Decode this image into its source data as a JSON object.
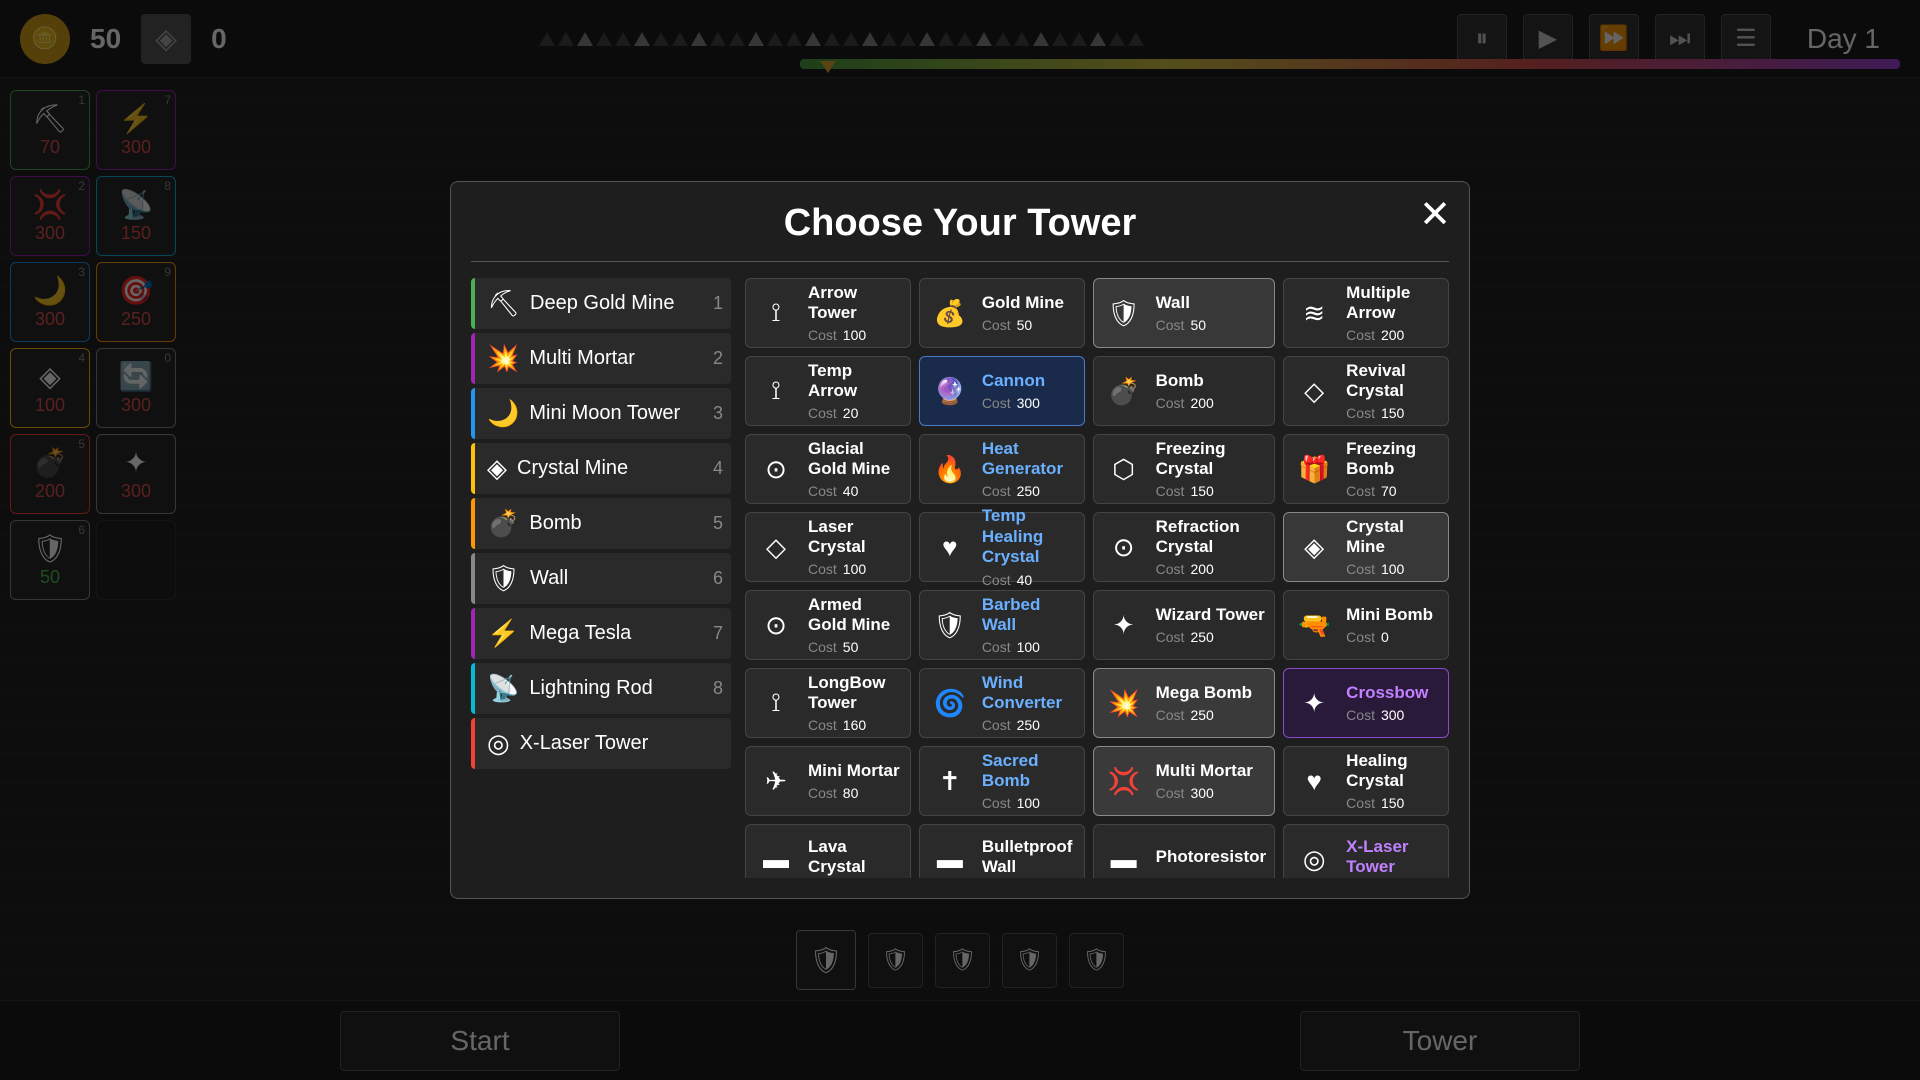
{
  "topbar": {
    "gold": "50",
    "crystals": "0",
    "day": "Day 1",
    "controls": {
      "pause": "⏸",
      "play": "▶",
      "fast": "⏩",
      "faster": "⏭",
      "menu": "☰"
    }
  },
  "modal": {
    "title": "Choose Your Tower",
    "close": "✕",
    "list": [
      {
        "name": "Deep Gold Mine",
        "icon": "⛏",
        "num": "1",
        "border": "green"
      },
      {
        "name": "Multi Mortar",
        "icon": "💥",
        "num": "2",
        "border": "purple"
      },
      {
        "name": "Mini Moon Tower",
        "icon": "🌙",
        "num": "3",
        "border": "blue"
      },
      {
        "name": "Crystal Mine",
        "icon": "◈",
        "num": "4",
        "border": "yellow"
      },
      {
        "name": "Bomb",
        "icon": "💣",
        "num": "5",
        "border": "orange"
      },
      {
        "name": "Wall",
        "icon": "🛡",
        "num": "6",
        "border": "gray"
      },
      {
        "name": "Mega Tesla",
        "icon": "⚡",
        "num": "7",
        "border": "purple"
      },
      {
        "name": "Lightning Rod",
        "icon": "📡",
        "num": "8",
        "border": "cyan"
      },
      {
        "name": "X-Laser Tower",
        "icon": "◎",
        "num": "",
        "border": "red"
      }
    ],
    "grid": [
      {
        "name": "Arrow Tower",
        "icon": "🏹",
        "cost": "100",
        "style": "normal"
      },
      {
        "name": "Gold Mine",
        "icon": "💰",
        "cost": "50",
        "style": "normal"
      },
      {
        "name": "Wall",
        "icon": "🛡",
        "cost": "50",
        "style": "selected-gray"
      },
      {
        "name": "Multiple Arrow",
        "icon": "≋",
        "cost": "200",
        "style": "normal"
      },
      {
        "name": "Temp Arrow",
        "icon": "🏹",
        "cost": "20",
        "style": "normal"
      },
      {
        "name": "Cannon",
        "icon": "🔮",
        "cost": "300",
        "style": "selected-blue",
        "nameColor": "blue"
      },
      {
        "name": "Bomb",
        "icon": "💣",
        "cost": "200",
        "style": "normal"
      },
      {
        "name": "Revival Crystal",
        "icon": "◇",
        "cost": "150",
        "style": "normal"
      },
      {
        "name": "Glacial Gold Mine",
        "icon": "⊙",
        "cost": "40",
        "style": "normal"
      },
      {
        "name": "Heat Generator",
        "icon": "🔥",
        "cost": "250",
        "style": "normal",
        "nameColor": "blue"
      },
      {
        "name": "Freezing Crystal",
        "icon": "⬡",
        "cost": "150",
        "style": "normal"
      },
      {
        "name": "Freezing Bomb",
        "icon": "🎁",
        "cost": "70",
        "style": "normal"
      },
      {
        "name": "Laser Crystal",
        "icon": "◇",
        "cost": "100",
        "style": "normal"
      },
      {
        "name": "Temp Healing Crystal",
        "icon": "♥",
        "cost": "40",
        "style": "normal",
        "nameColor": "blue"
      },
      {
        "name": "Refraction Crystal",
        "icon": "⊙",
        "cost": "200",
        "style": "normal"
      },
      {
        "name": "Crystal Mine",
        "icon": "◈",
        "cost": "100",
        "style": "selected-gray"
      },
      {
        "name": "Armed Gold Mine",
        "icon": "⊙",
        "cost": "50",
        "style": "normal"
      },
      {
        "name": "Barbed Wall",
        "icon": "🛡",
        "cost": "100",
        "style": "normal",
        "nameColor": "blue"
      },
      {
        "name": "Wizard Tower",
        "icon": "✦",
        "cost": "250",
        "style": "normal"
      },
      {
        "name": "Mini Bomb",
        "icon": "🔫",
        "cost": "0",
        "style": "normal"
      },
      {
        "name": "LongBow Tower",
        "icon": "🏹",
        "cost": "160",
        "style": "normal"
      },
      {
        "name": "Wind Converter",
        "icon": "🌀",
        "cost": "250",
        "style": "normal",
        "nameColor": "blue"
      },
      {
        "name": "Mega Bomb",
        "icon": "💥",
        "cost": "250",
        "style": "highlighted"
      },
      {
        "name": "Crossbow",
        "icon": "✦",
        "cost": "300",
        "style": "selected-purple",
        "nameColor": "purple"
      },
      {
        "name": "Mini Mortar",
        "icon": "✈",
        "cost": "80",
        "style": "normal"
      },
      {
        "name": "Sacred Bomb",
        "icon": "✝",
        "cost": "100",
        "style": "normal",
        "nameColor": "blue"
      },
      {
        "name": "Multi Mortar",
        "icon": "💢",
        "cost": "300",
        "style": "highlighted"
      },
      {
        "name": "Healing Crystal",
        "icon": "♥",
        "cost": "150",
        "style": "normal"
      },
      {
        "name": "Lava Crystal",
        "icon": "▬",
        "cost": "",
        "style": "normal"
      },
      {
        "name": "Bulletproof Wall",
        "icon": "▬",
        "cost": "",
        "style": "normal"
      },
      {
        "name": "Photoresistor",
        "icon": "▬",
        "cost": "",
        "style": "normal"
      },
      {
        "name": "X-Laser Tower",
        "icon": "◎",
        "cost": "",
        "style": "normal",
        "nameColor": "purple"
      }
    ]
  },
  "bottombar": {
    "start_label": "Start",
    "tower_label": "Tower"
  },
  "sidebar_slots": [
    {
      "icon": "⛏",
      "cost": "70",
      "costColor": "red",
      "num": "1"
    },
    {
      "icon": "⚡",
      "cost": "300",
      "costColor": "red",
      "num": "7"
    },
    {
      "icon": "💢",
      "cost": "300",
      "costColor": "red",
      "num": "2"
    },
    {
      "icon": "📡",
      "cost": "150",
      "costColor": "red",
      "num": "8"
    },
    {
      "icon": "🌙",
      "cost": "300",
      "costColor": "red",
      "num": "3"
    },
    {
      "icon": "🎯",
      "cost": "250",
      "costColor": "red",
      "num": "9"
    },
    {
      "icon": "◈",
      "cost": "100",
      "costColor": "red",
      "num": "4"
    },
    {
      "icon": "🔄",
      "cost": "300",
      "costColor": "red",
      "num": "0"
    },
    {
      "icon": "💣",
      "cost": "200",
      "costColor": "red",
      "num": "5"
    },
    {
      "icon": "✦",
      "cost": "300",
      "costColor": "red",
      "num": ""
    },
    {
      "icon": "🛡",
      "cost": "50",
      "costColor": "green",
      "num": "6"
    },
    {
      "icon": "",
      "cost": "",
      "costColor": "white",
      "num": ""
    }
  ],
  "bottom_icons": [
    "🛡",
    "🛡",
    "🛡",
    "🛡"
  ],
  "bottom_center_icon": "🛡"
}
